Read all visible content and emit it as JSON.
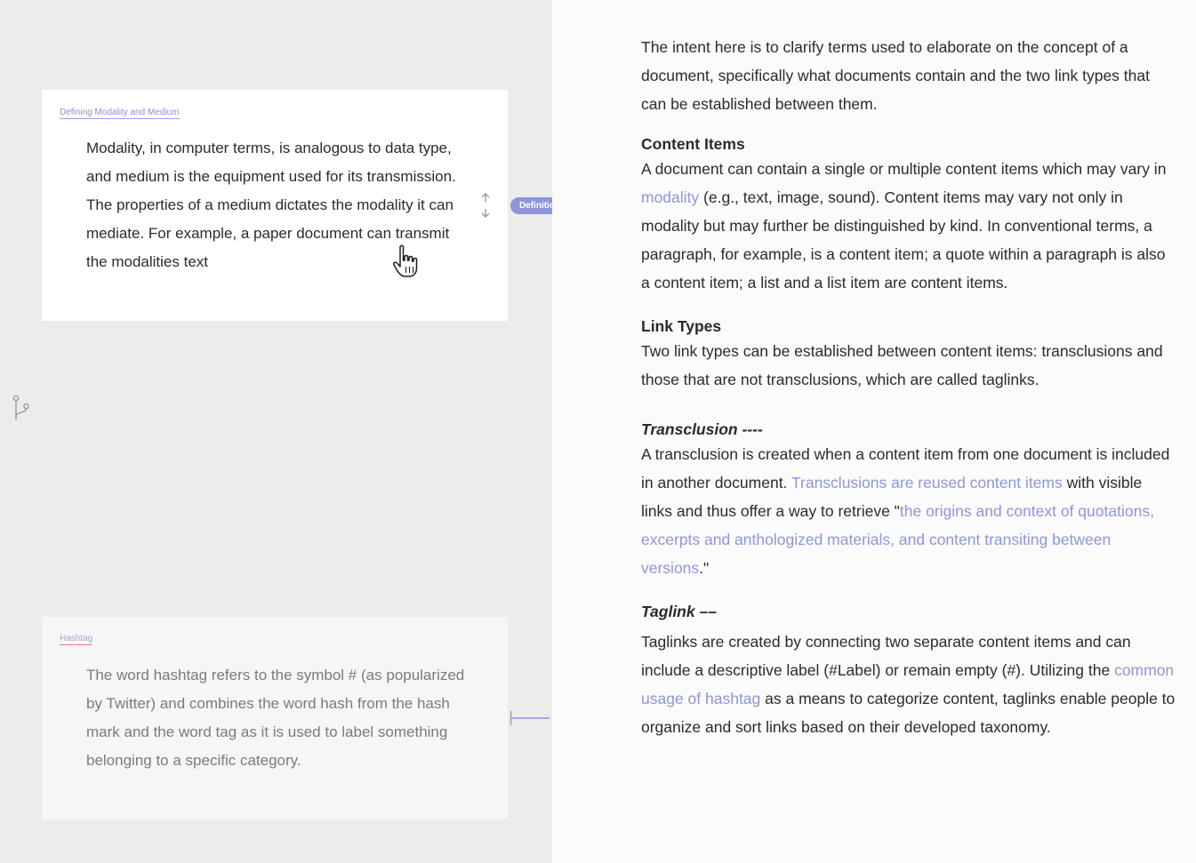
{
  "left": {
    "definition_card": {
      "tag": "Defining Modality and Medium",
      "body": "Modality, in computer terms, is analogous to data type, and medium is the equipment used for its transmission. The properties of a medium dictates the modality it can mediate. For example, a paper document can transmit the modalities text",
      "badge": "Definition"
    },
    "hashtag_card": {
      "tag": "Hashtag",
      "body": "The word hashtag refers to the symbol # (as popularized by Twitter) and combines the word hash from the hash mark and the word tag as it is used to label something belonging to a specific category."
    },
    "icons": {
      "resize": "vertical-resize-icon",
      "branch": "branch-icon",
      "cursor": "hand-cursor-icon",
      "connector": "taglink-connector-icon"
    }
  },
  "document": {
    "intro": "The intent here is to clarify terms used to elaborate on the concept of a document, specifically what documents contain and the two link types that can be established between them.",
    "content_items": {
      "heading": "Content Items",
      "p1": "A document can contain a single or multiple content items which may vary in ",
      "link": "modality",
      "p2": " (e.g., text, image, sound). Content items may vary not only in modality but may further be distinguished by kind. In conventional terms, a paragraph, for example, is a content item; a quote within a paragraph is also a content item; a list and a list item are content items."
    },
    "link_types": {
      "heading": "Link Types",
      "body": "Two link types can be established between content items: transclusions and those that are not transclusions, which are called taglinks."
    },
    "transclusion": {
      "heading": "Transclusion ----",
      "p1": "A transclusion is created when a content item from one document is included in another document. ",
      "link1": "Transclusions are reused content items",
      "p2": " with visible links and thus offer a way to retrieve \"",
      "link2": "the origins and context of quotations, excerpts and anthologized materials, and content transiting between versions",
      "p3": ".\""
    },
    "taglink": {
      "heading": "Taglink ––",
      "p1": "Taglinks are created by connecting two separate content items and can include a descriptive label (#Label) or remain empty (#). Utilizing the ",
      "link": "common usage of hashtag",
      "p2": " as a means to categorize content, taglinks enable people to organize and sort links based on their developed taxonomy."
    }
  },
  "colors": {
    "accent": "#8e94dc",
    "link": "#9096d2",
    "left_bg": "#ececea",
    "right_bg": "#fbfbfc",
    "hashtag_underline": "#e07a80"
  }
}
